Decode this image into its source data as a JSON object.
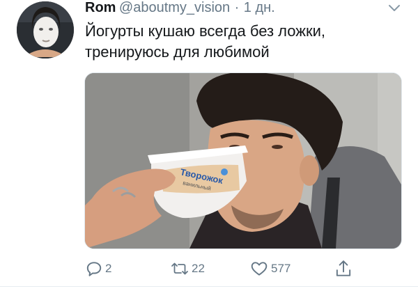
{
  "tweet": {
    "author_name": "Rom",
    "handle": "@aboutmy_vision",
    "separator": "·",
    "time": "1 дн.",
    "text_lines": [
      "Йогурты кушаю всегда без ложки,",
      "тренируюсь для любимой"
    ],
    "image_texts": {
      "brand": "Творожок",
      "sub": "ванильный"
    }
  },
  "actions": {
    "reply_count": "2",
    "retweet_count": "22",
    "like_count": "577"
  },
  "colors": {
    "text": "#14171a",
    "muted": "#657786",
    "border": "#e1e8ed"
  },
  "icons": [
    "chevron-down-icon",
    "reply-icon",
    "retweet-icon",
    "heart-icon",
    "share-icon"
  ]
}
